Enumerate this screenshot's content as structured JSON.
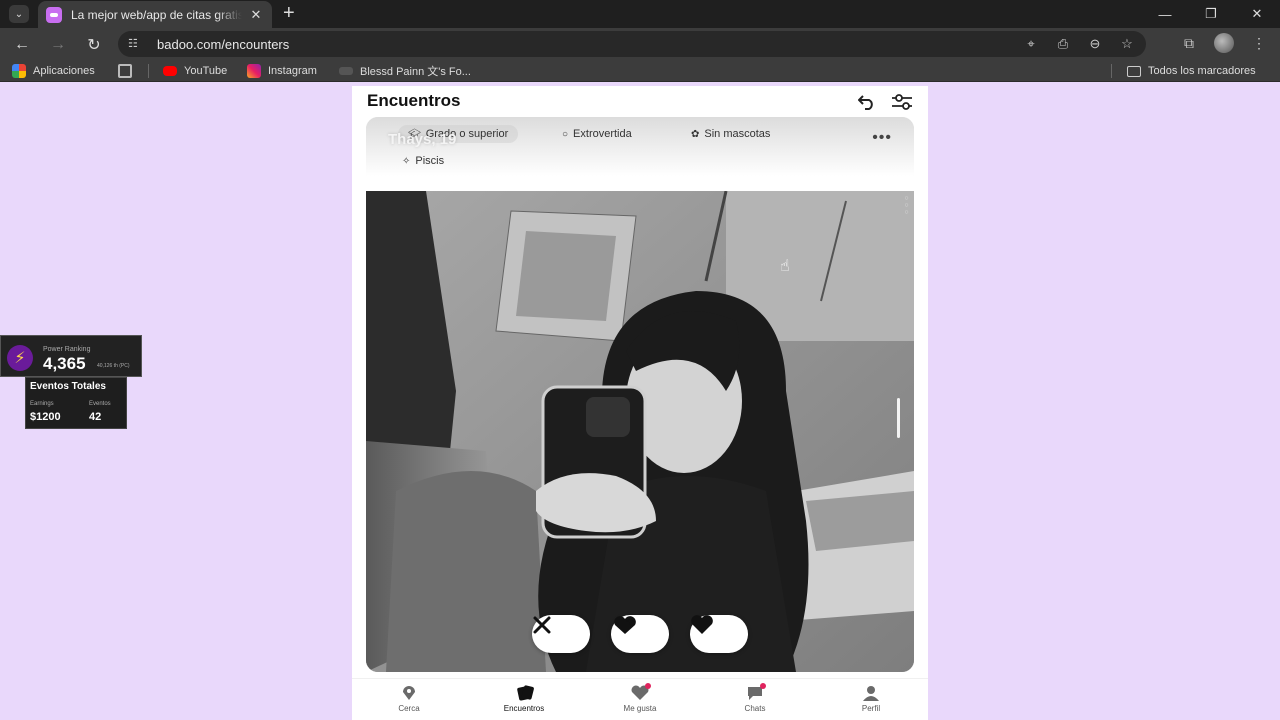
{
  "browser": {
    "tab_title": "La mejor web/app de citas gratis",
    "url": "badoo.com/encounters",
    "bookmarks": [
      {
        "label": "Aplicaciones",
        "icon": "apps-grid-icon"
      },
      {
        "label": "YouTube",
        "icon": "youtube-icon"
      },
      {
        "label": "Instagram",
        "icon": "instagram-icon"
      },
      {
        "label": "Blessd Painn 文's Fo...",
        "icon": "soundcloud-icon"
      }
    ],
    "all_bookmarks_label": "Todos los marcadores"
  },
  "app": {
    "title": "Encuentros",
    "profile": {
      "name": "Thays, 19",
      "chips": [
        {
          "label": "Grado o superior",
          "icon": "graduation-icon"
        },
        {
          "label": "Extrovertida",
          "icon": "speech-bubble-icon"
        },
        {
          "label": "Sin mascotas",
          "icon": "paw-icon"
        },
        {
          "label": "Piscis",
          "icon": "zodiac-icon"
        }
      ]
    },
    "actions": [
      "pass-x-icon",
      "superlike-icon",
      "like-heart-icon"
    ],
    "nav": [
      {
        "label": "Cerca",
        "icon": "location-pin-icon"
      },
      {
        "label": "Encuentros",
        "icon": "cards-icon",
        "active": true
      },
      {
        "label": "Me gusta",
        "icon": "heart-icon",
        "notification": true
      },
      {
        "label": "Chats",
        "icon": "chat-icon",
        "notification": true
      },
      {
        "label": "Perfil",
        "icon": "person-icon"
      }
    ],
    "colors": {
      "background": "#e9d8fb",
      "notification": "#e0245e"
    }
  },
  "overlay": {
    "power_label": "Power Ranking",
    "power_value": "4,365",
    "power_sub": "40,126 th (PC)",
    "title": "Eventos Totales",
    "earnings_label": "Earnings",
    "earnings_value": "$1200",
    "events_label": "Eventos",
    "events_value": "42"
  }
}
